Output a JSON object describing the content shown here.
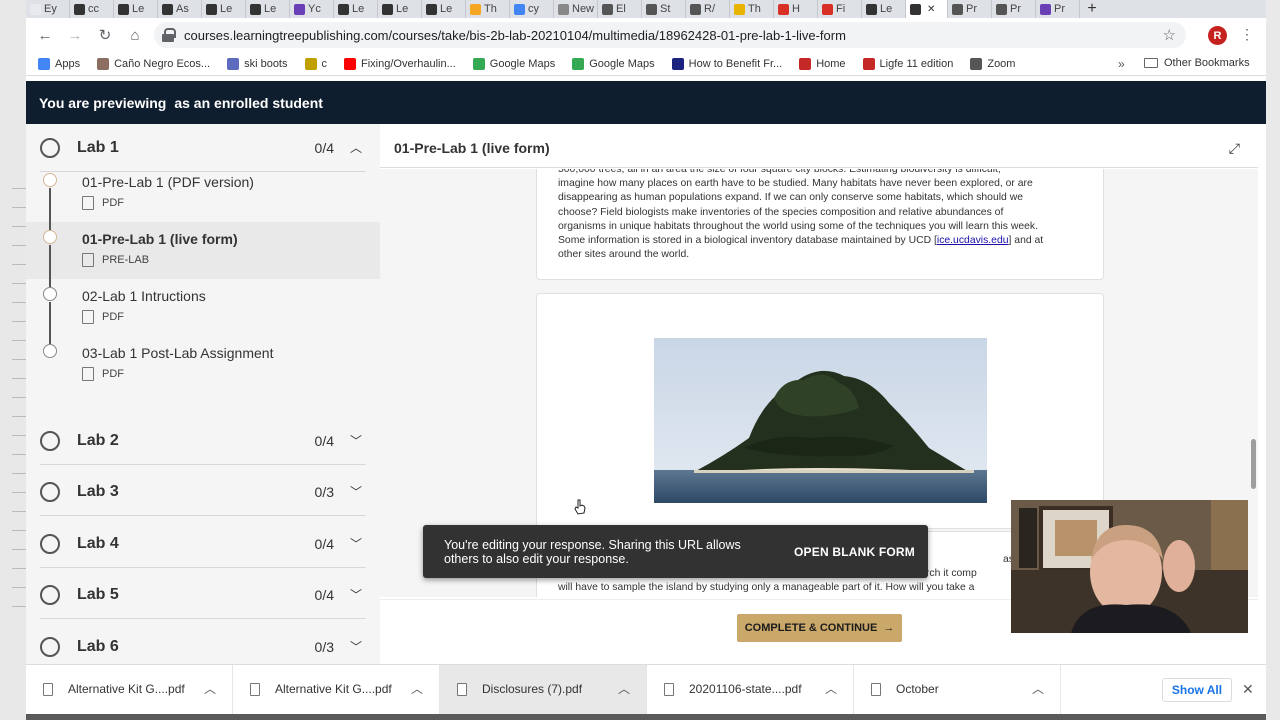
{
  "browser": {
    "tabs": [
      {
        "title": "Ey",
        "color": "#e8eaed"
      },
      {
        "title": "cc",
        "color": "#333333"
      },
      {
        "title": "Le",
        "color": "#333333"
      },
      {
        "title": "As",
        "color": "#333333"
      },
      {
        "title": "Le",
        "color": "#333333"
      },
      {
        "title": "Le",
        "color": "#333333"
      },
      {
        "title": "Yc",
        "color": "#6a3fb5"
      },
      {
        "title": "Le",
        "color": "#333333"
      },
      {
        "title": "Le",
        "color": "#333333"
      },
      {
        "title": "Le",
        "color": "#333333"
      },
      {
        "title": "Th",
        "color": "#f5a623"
      },
      {
        "title": "cy",
        "color": "#4285f4"
      },
      {
        "title": "New",
        "color": "#888888"
      },
      {
        "title": "El",
        "color": "#555555"
      },
      {
        "title": "St",
        "color": "#555555"
      },
      {
        "title": "R/",
        "color": "#555555"
      },
      {
        "title": "Th",
        "color": "#e8b400"
      },
      {
        "title": "H",
        "color": "#d93025"
      },
      {
        "title": "Fi",
        "color": "#d93025"
      },
      {
        "title": "Le",
        "color": "#333333"
      },
      {
        "title": "",
        "color": "#333333",
        "active": true
      },
      {
        "title": "Pr",
        "color": "#555555"
      },
      {
        "title": "Pr",
        "color": "#555555"
      },
      {
        "title": "Pr",
        "color": "#6a3fb5"
      }
    ],
    "url": "courses.learningtreepublishing.com/courses/take/bis-2b-lab-20210104/multimedia/18962428-01-pre-lab-1-live-form",
    "profile_initial": "R",
    "bookmarks": [
      {
        "label": "Apps",
        "color": "#4285f4"
      },
      {
        "label": "Caño Negro Ecos...",
        "color": "#8d6e63"
      },
      {
        "label": "ski boots",
        "color": "#5c6bc0"
      },
      {
        "label": "c",
        "color": "#c0a000"
      },
      {
        "label": "Fixing/Overhaulin...",
        "color": "#ff0000"
      },
      {
        "label": "Google Maps",
        "color": "#34a853"
      },
      {
        "label": "Google Maps",
        "color": "#34a853"
      },
      {
        "label": "How to Benefit Fr...",
        "color": "#1a237e"
      },
      {
        "label": "Home",
        "color": "#c62828"
      },
      {
        "label": "Ligfe 11 edition",
        "color": "#c62828"
      },
      {
        "label": "Zoom",
        "color": "#555555"
      }
    ],
    "bookmarks_more": "»",
    "other_bookmarks": "Other Bookmarks"
  },
  "banner": {
    "prefix": "You are previewing",
    "suffix": "as an enrolled student"
  },
  "sidebar": {
    "lab1": {
      "title": "Lab 1",
      "count": "0/4"
    },
    "lessons": [
      {
        "name": "01-Pre-Lab 1 (PDF version)",
        "type": "PDF"
      },
      {
        "name": "01-Pre-Lab 1 (live form)",
        "type": "PRE-LAB"
      },
      {
        "name": "02-Lab 1 Intructions",
        "type": "PDF"
      },
      {
        "name": "03-Lab 1 Post-Lab Assignment",
        "type": "PDF"
      }
    ],
    "labs": [
      {
        "title": "Lab 2",
        "count": "0/4"
      },
      {
        "title": "Lab 3",
        "count": "0/3"
      },
      {
        "title": "Lab 4",
        "count": "0/4"
      },
      {
        "title": "Lab 5",
        "count": "0/4"
      },
      {
        "title": "Lab 6",
        "count": "0/3"
      }
    ]
  },
  "main": {
    "title": "01-Pre-Lab 1 (live form)",
    "para1_lines": [
      "500,000 trees, all in an area the size of four square city blocks. Estimating biodiversity is difficult;",
      "imagine how many places on earth have to be studied. Many habitats have never been explored, or are",
      "disappearing as human populations expand. If we can only conserve some habitats, which should we",
      "choose? Field biologists make inventories of the species composition and relative abundances of",
      "organisms in unique habitats throughout the world using some of the techniques you will learn this week."
    ],
    "para1_last_prefix": "Some information is stored in a biological inventory database maintained by UCD [",
    "para1_link": "ice.ucdavis.edu",
    "para1_last_suffix": "] and at",
    "para1_tail": "other sites around the world.",
    "para2_lines": [
      "ask of finding ou",
      "organisms are present. You notice immediately that the island is too large to search it comp",
      "will have to sample the island by studying only a manageable part of it. How will you take a"
    ],
    "continue_label": "COMPLETE & CONTINUE",
    "continue_arrow": "→"
  },
  "toast": {
    "message": "You're editing your response. Sharing this URL allows others to also edit your response.",
    "action": "OPEN BLANK FORM"
  },
  "downloads": {
    "items": [
      "Alternative Kit G....pdf",
      "Alternative Kit G....pdf",
      "Disclosures (7).pdf",
      "20201106-state....pdf",
      "October"
    ],
    "show_all": "Show All"
  }
}
